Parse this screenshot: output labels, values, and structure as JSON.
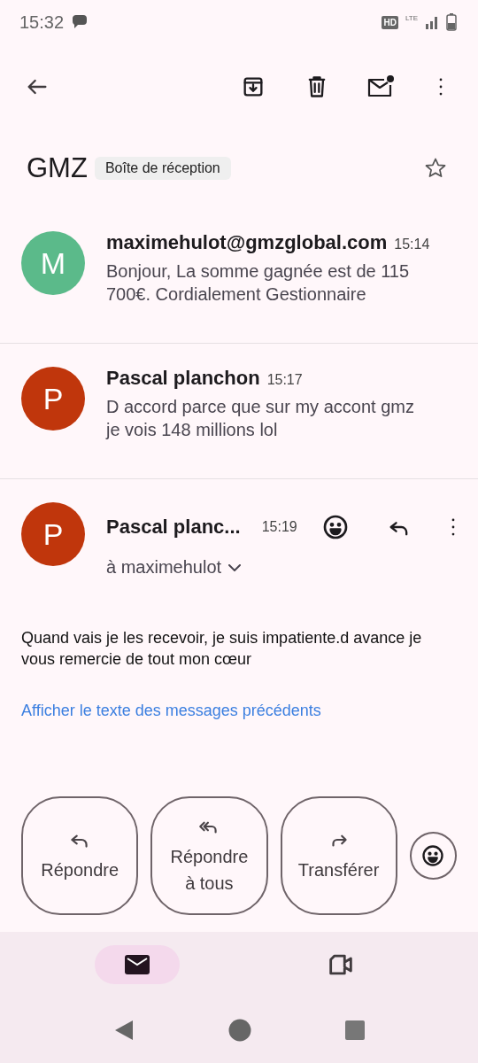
{
  "status_bar": {
    "time": "15:32",
    "hd": "HD",
    "network": "LTE"
  },
  "thread": {
    "subject": "GMZ",
    "label": "Boîte de réception",
    "starred": false
  },
  "messages": [
    {
      "kind": "collapsed",
      "avatar": "M",
      "color": "#5bba8a",
      "sender": "maximehulot@gmzglobal.com",
      "time": "15:14",
      "snippet": "Bonjour, La somme gagnée est de 115 700€. Cordialement Gestionnaire"
    },
    {
      "kind": "collapsed",
      "avatar": "P",
      "color": "#c0360c",
      "sender": "Pascal planchon",
      "time": "15:17",
      "snippet": "D accord parce que sur my accont gmz je vois 148 millions lol"
    },
    {
      "kind": "expanded",
      "avatar": "P",
      "color": "#c0360c",
      "sender": "Pascal planc...",
      "time": "15:19",
      "recipient": "à maximehulot",
      "body": "Quand vais je les recevoir, je suis impatiente.d avance je vous remercie de tout mon cœur",
      "link": "Afficher le texte des messages précédents"
    }
  ],
  "actions": [
    {
      "kind": "reply",
      "label": "Répondre"
    },
    {
      "kind": "reply_all",
      "label": "Répondre à tous"
    },
    {
      "kind": "forward",
      "label": "Transférer"
    }
  ],
  "bottom_nav": [
    {
      "kind": "mail",
      "selected": true
    },
    {
      "kind": "video",
      "selected": false
    }
  ]
}
